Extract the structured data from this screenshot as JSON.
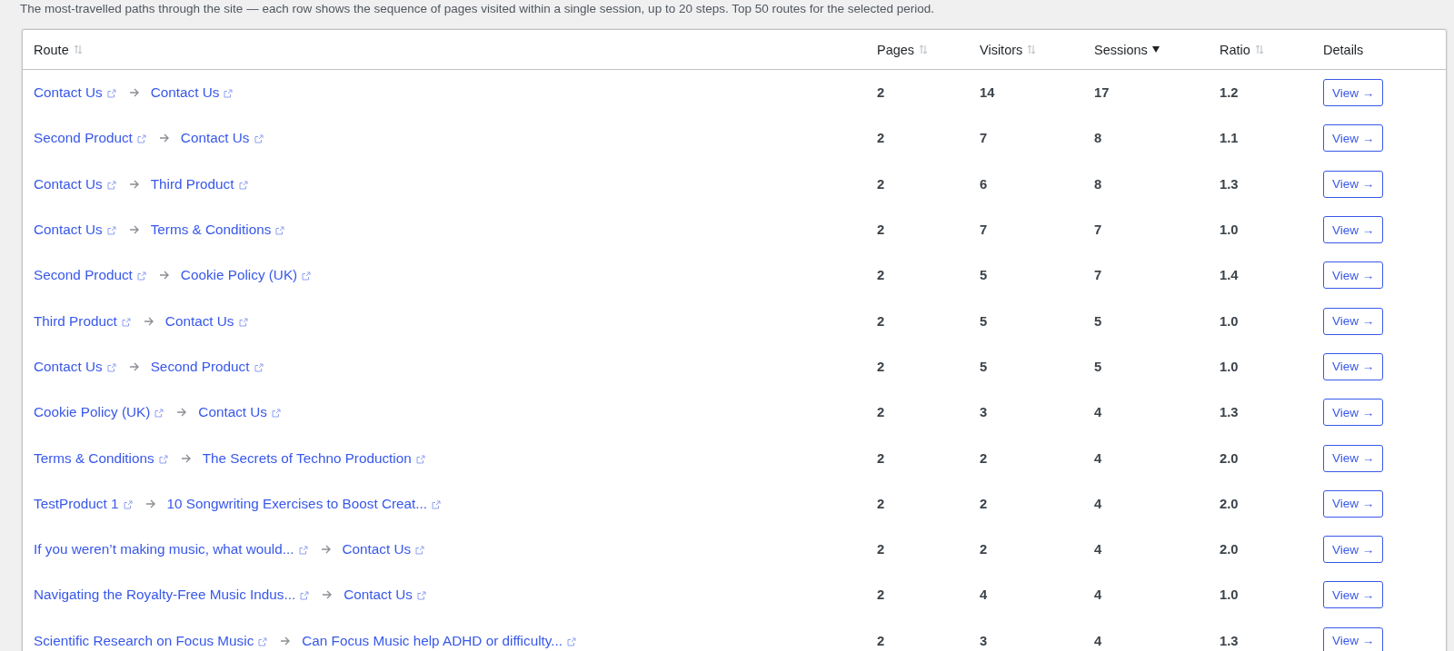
{
  "description": "The most-travelled paths through the site — each row shows the sequence of pages visited within a single session, up to 20 steps. Top 50 routes for the selected period.",
  "table": {
    "columns": [
      {
        "label": "Route",
        "sortable": true,
        "sorted": false
      },
      {
        "label": "Pages",
        "sortable": true,
        "sorted": false
      },
      {
        "label": "Visitors",
        "sortable": true,
        "sorted": false
      },
      {
        "label": "Sessions",
        "sortable": true,
        "sorted": true
      },
      {
        "label": "Ratio",
        "sortable": true,
        "sorted": false
      },
      {
        "label": "Details",
        "sortable": false
      }
    ],
    "rows": [
      {
        "route": [
          "Contact Us",
          "Contact Us"
        ],
        "pages": "2",
        "visitors": "14",
        "sessions": "17",
        "ratio": "1.2",
        "action": "View →"
      },
      {
        "route": [
          "Second Product",
          "Contact Us"
        ],
        "pages": "2",
        "visitors": "7",
        "sessions": "8",
        "ratio": "1.1",
        "action": "View →"
      },
      {
        "route": [
          "Contact Us",
          "Third Product"
        ],
        "pages": "2",
        "visitors": "6",
        "sessions": "8",
        "ratio": "1.3",
        "action": "View →"
      },
      {
        "route": [
          "Contact Us",
          "Terms & Conditions"
        ],
        "pages": "2",
        "visitors": "7",
        "sessions": "7",
        "ratio": "1.0",
        "action": "View →"
      },
      {
        "route": [
          "Second Product",
          "Cookie Policy (UK)"
        ],
        "pages": "2",
        "visitors": "5",
        "sessions": "7",
        "ratio": "1.4",
        "action": "View →"
      },
      {
        "route": [
          "Third Product",
          "Contact Us"
        ],
        "pages": "2",
        "visitors": "5",
        "sessions": "5",
        "ratio": "1.0",
        "action": "View →"
      },
      {
        "route": [
          "Contact Us",
          "Second Product"
        ],
        "pages": "2",
        "visitors": "5",
        "sessions": "5",
        "ratio": "1.0",
        "action": "View →"
      },
      {
        "route": [
          "Cookie Policy (UK)",
          "Contact Us"
        ],
        "pages": "2",
        "visitors": "3",
        "sessions": "4",
        "ratio": "1.3",
        "action": "View →"
      },
      {
        "route": [
          "Terms & Conditions",
          "The Secrets of Techno Production"
        ],
        "pages": "2",
        "visitors": "2",
        "sessions": "4",
        "ratio": "2.0",
        "action": "View →"
      },
      {
        "route": [
          "TestProduct 1",
          "10 Songwriting Exercises to Boost Creat..."
        ],
        "pages": "2",
        "visitors": "2",
        "sessions": "4",
        "ratio": "2.0",
        "action": "View →"
      },
      {
        "route": [
          "If you weren’t making music, what would...",
          "Contact Us"
        ],
        "pages": "2",
        "visitors": "2",
        "sessions": "4",
        "ratio": "2.0",
        "action": "View →"
      },
      {
        "route": [
          "Navigating the Royalty-Free Music Indus...",
          "Contact Us"
        ],
        "pages": "2",
        "visitors": "4",
        "sessions": "4",
        "ratio": "1.0",
        "action": "View →"
      },
      {
        "route": [
          "Scientific Research on Focus Music",
          "Can Focus Music help ADHD or difficulty..."
        ],
        "pages": "2",
        "visitors": "3",
        "sessions": "4",
        "ratio": "1.3",
        "action": "View →"
      }
    ]
  }
}
